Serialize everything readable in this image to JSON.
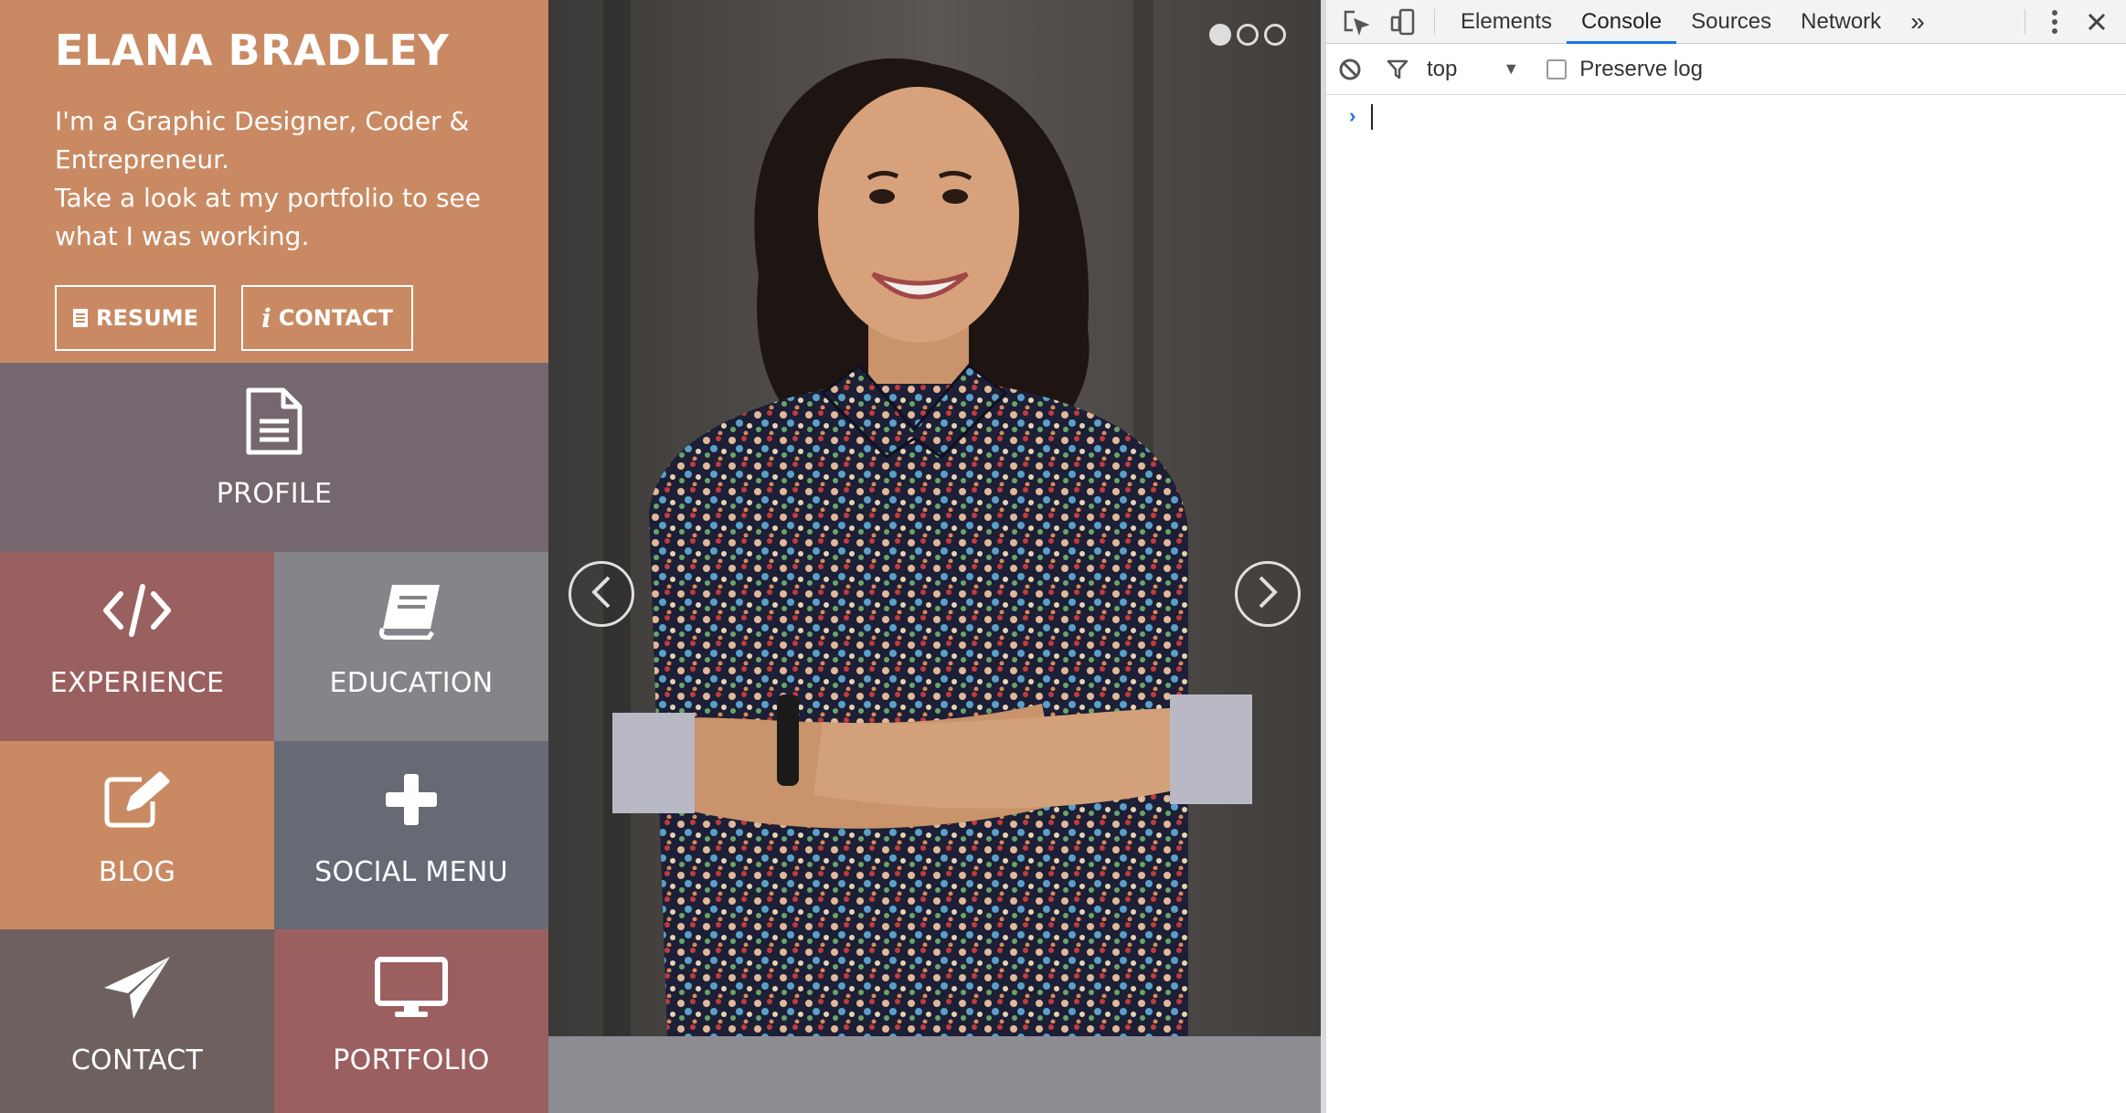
{
  "profile": {
    "name": "ELANA BRADLEY",
    "intro_line1": "I'm a Graphic Designer, Coder & Entrepreneur.",
    "intro_line2": "Take a look at my portfolio to see what I was working.",
    "resume_button": "RESUME",
    "contact_button": "CONTACT",
    "resume_icon": "document-icon",
    "contact_icon": "info-icon"
  },
  "menu": {
    "tiles": [
      {
        "label": "PROFILE",
        "icon": "file-text-icon",
        "color": "#75676f"
      },
      {
        "label": "EXPERIENCE",
        "icon": "code-icon",
        "color": "#9a6060"
      },
      {
        "label": "EDUCATION",
        "icon": "book-icon",
        "color": "#848489"
      },
      {
        "label": "BLOG",
        "icon": "edit-icon",
        "color": "#c98a63"
      },
      {
        "label": "SOCIAL MENU",
        "icon": "plus-icon",
        "color": "#656a74"
      },
      {
        "label": "CONTACT",
        "icon": "paper-plane-icon",
        "color": "#6d605f"
      },
      {
        "label": "PORTFOLIO",
        "icon": "monitor-icon",
        "color": "#9b5f60"
      }
    ]
  },
  "slider": {
    "slide_count": 3,
    "active_slide": 1,
    "prev_icon": "chevron-left-icon",
    "next_icon": "chevron-right-icon"
  },
  "devtools": {
    "tabs": [
      "Elements",
      "Console",
      "Sources",
      "Network"
    ],
    "active_tab": "Console",
    "more_tabs": "»",
    "context": "top",
    "preserve_log_label": "Preserve log",
    "preserve_log_checked": false,
    "accent_color": "#1a73e8"
  }
}
